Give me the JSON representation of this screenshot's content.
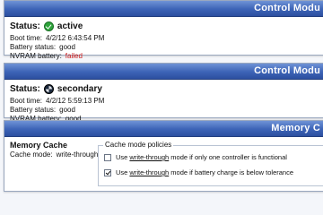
{
  "panels": [
    {
      "title": "Control Modu",
      "status_label": "Status:",
      "status_value": "active",
      "boot_label": "Boot time:",
      "boot_value": "4/2/12 6:43:54 PM",
      "battery_label": "Battery status:",
      "battery_value": "good",
      "nvram_label": "NVRAM battery:",
      "nvram_value": "failed"
    },
    {
      "title": "Control Modu",
      "status_label": "Status:",
      "status_value": "secondary",
      "boot_label": "Boot time:",
      "boot_value": "4/2/12 5:59:13 PM",
      "battery_label": "Battery status:",
      "battery_value": "good",
      "nvram_label": "NVRAM battery:",
      "nvram_value": "good"
    }
  ],
  "memory": {
    "title": "Memory C",
    "section_title": "Memory Cache",
    "mode_label": "Cache mode:",
    "mode_value": "write-through",
    "policies_legend": "Cache mode policies",
    "option1_prefix": "Use ",
    "option1_link": "write-through",
    "option1_suffix": " mode if only one controller is functional",
    "option1_checked": false,
    "option2_prefix": "Use ",
    "option2_link": "write-through",
    "option2_suffix": " mode if battery charge is below tolerance",
    "option2_checked": true
  },
  "colors": {
    "header": "#3c63b6",
    "failed": "#d01e1e",
    "ok_icon": "#2ea43b"
  }
}
